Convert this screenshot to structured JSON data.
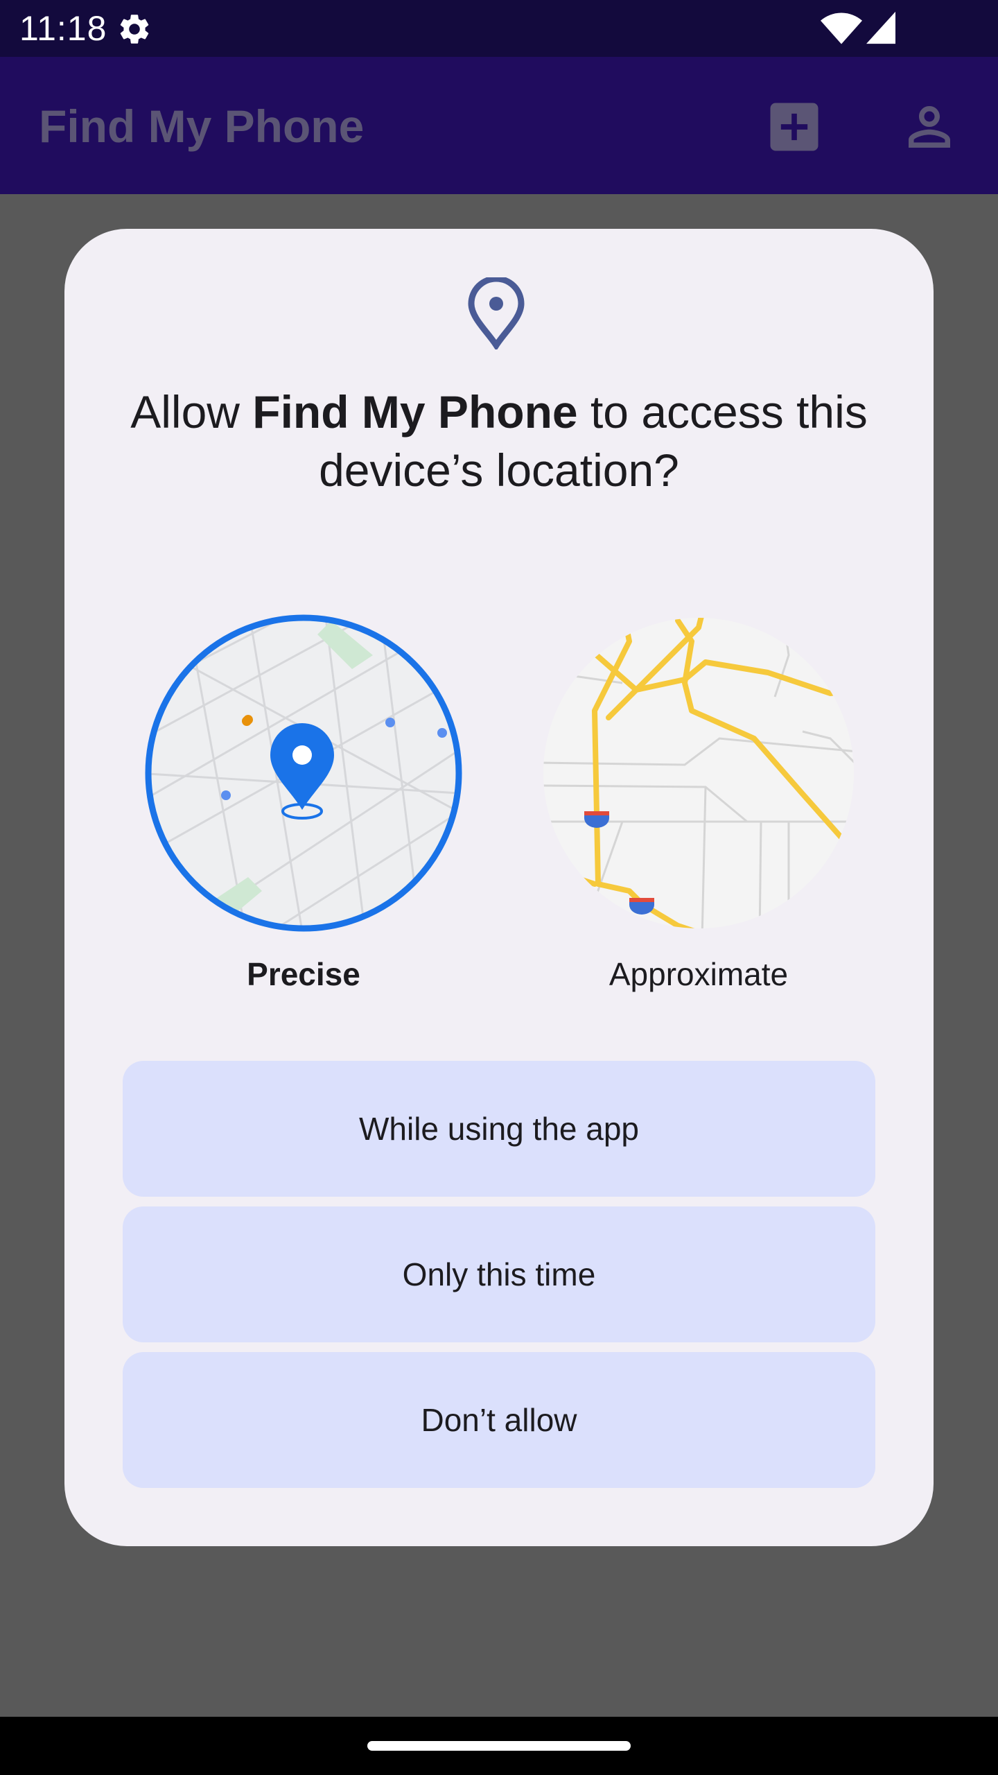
{
  "status_bar": {
    "time": "11:18",
    "icons": [
      "settings-gear-icon",
      "wifi-icon",
      "cell-signal-icon"
    ]
  },
  "app_bar": {
    "title": "Find My Phone",
    "actions": [
      "add-box-icon",
      "account-icon"
    ]
  },
  "dialog": {
    "icon": "location-pin-icon",
    "title_prefix": "Allow ",
    "title_app": "Find My Phone",
    "title_suffix": " to access this device’s location?",
    "options": {
      "precise_label": "Precise",
      "approximate_label": "Approximate",
      "selected": "precise"
    },
    "buttons": {
      "while_using": "While using the app",
      "only_this_time": "Only this time",
      "dont_allow": "Don’t allow"
    }
  },
  "colors": {
    "status_bar": "#130a3d",
    "app_bar": "#200c5e",
    "dialog_bg": "#f2eff5",
    "button_bg": "#dbe0fc",
    "accent_blue": "#1a73e8",
    "road_yellow": "#f6c93c"
  }
}
